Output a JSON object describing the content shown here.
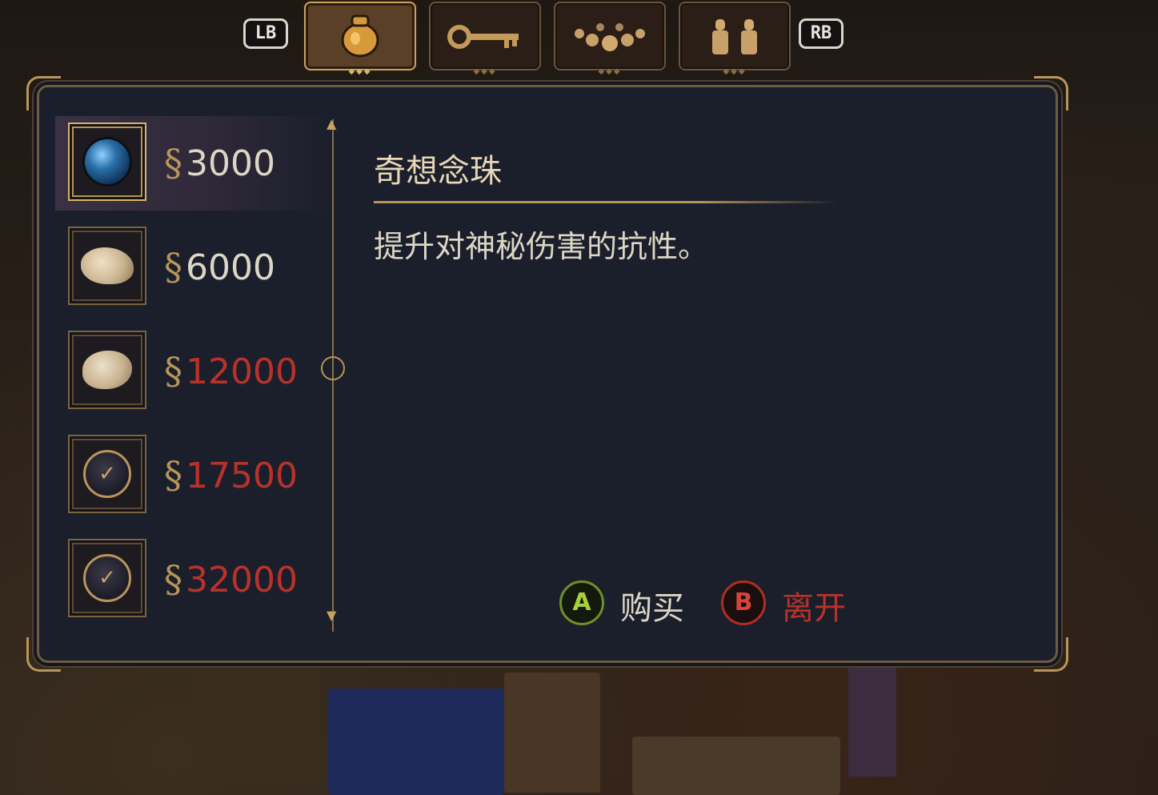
{
  "tabs": {
    "left_bumper": "LB",
    "right_bumper": "RB",
    "items": [
      {
        "icon": "coin-bag-icon",
        "active": true
      },
      {
        "icon": "key-icon",
        "active": false
      },
      {
        "icon": "rosary-beads-icon",
        "active": false
      },
      {
        "icon": "figurines-icon",
        "active": false
      }
    ]
  },
  "shop": {
    "currency_symbol": "§",
    "items": [
      {
        "icon": "blue-orb-bead-icon",
        "price": "3000",
        "affordable": true,
        "selected": true
      },
      {
        "icon": "animal-skull-icon",
        "price": "6000",
        "affordable": true,
        "selected": false
      },
      {
        "icon": "bone-fragment-icon",
        "price": "12000",
        "affordable": false,
        "selected": false
      },
      {
        "icon": "rune-orb-icon",
        "price": "17500",
        "affordable": false,
        "selected": false
      },
      {
        "icon": "rune-orb-icon",
        "price": "32000",
        "affordable": false,
        "selected": false
      }
    ]
  },
  "detail": {
    "title": "奇想念珠",
    "description": "提升对神秘伤害的抗性。"
  },
  "prompts": {
    "buy_button": "A",
    "buy_label": "购买",
    "leave_button": "B",
    "leave_label": "离开"
  },
  "colors": {
    "panel_bg": "#1b1f2b",
    "gold_trim": "#b8955a",
    "unaffordable": "#b8322a",
    "text": "#ddd6c6"
  }
}
